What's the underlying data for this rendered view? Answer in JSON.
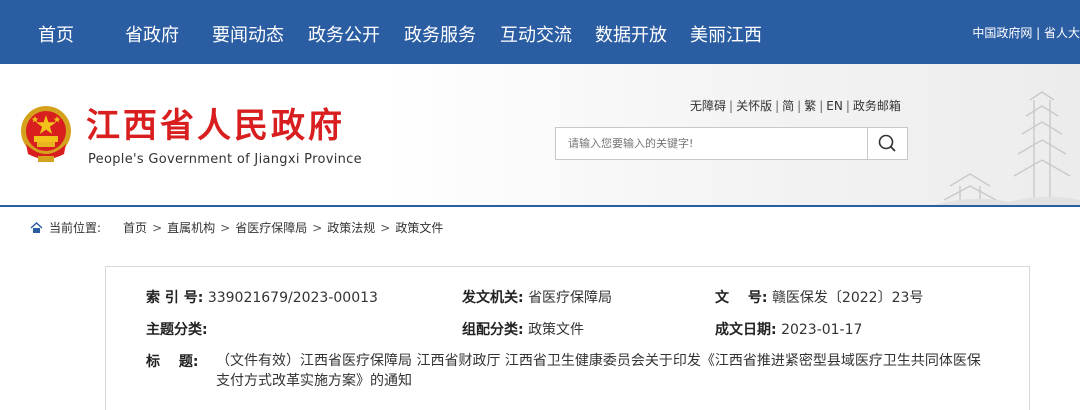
{
  "nav": {
    "items": [
      "首页",
      "省政府",
      "要闻动态",
      "政务公开",
      "政务服务",
      "互动交流",
      "数据开放",
      "美丽江西"
    ],
    "right_text": "中国政府网 | 省人大"
  },
  "header": {
    "title": "江西省人民政府",
    "subtitle": "People's Government of Jiangxi Province",
    "links": [
      "无障碍",
      "关怀版",
      "简",
      "繁",
      "EN",
      "政务邮箱"
    ],
    "search_placeholder": "请输入您要输入的关键字!"
  },
  "breadcrumb": {
    "label": "当前位置:",
    "items": [
      "首页",
      "直属机构",
      "省医疗保障局",
      "政策法规",
      "政策文件"
    ]
  },
  "doc": {
    "index_key": "索 引 号:",
    "index_val": "339021679/2023-00013",
    "issuer_key": "发文机关:",
    "issuer_val": "省医疗保障局",
    "docno_key": "文　 号:",
    "docno_val": "赣医保发〔2022〕23号",
    "topic_key": "主题分类:",
    "topic_val": "",
    "category_key": "组配分类:",
    "category_val": "政策文件",
    "date_key": "成文日期:",
    "date_val": "2023-01-17",
    "title_key": "标　  题:",
    "title_val": "（文件有效）江西省医疗保障局 江西省财政厅 江西省卫生健康委员会关于印发《江西省推进紧密型县域医疗卫生共同体医保支付方式改革实施方案》的通知"
  },
  "colors": {
    "nav_bg": "#2b5da3",
    "title_red": "#d81e1e"
  }
}
